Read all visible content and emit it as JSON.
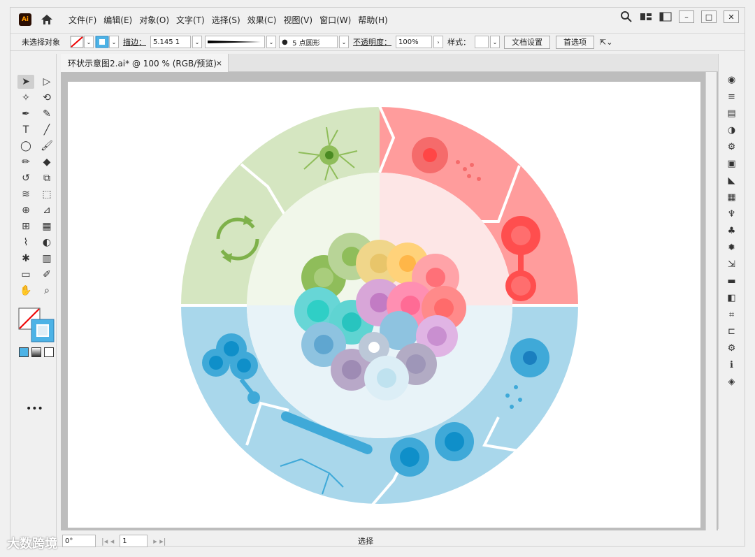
{
  "app": {
    "logo_text": "Ai"
  },
  "menu": [
    "文件(F)",
    "编辑(E)",
    "对象(O)",
    "文字(T)",
    "选择(S)",
    "效果(C)",
    "视图(V)",
    "窗口(W)",
    "帮助(H)"
  ],
  "control_bar": {
    "selection_status": "未选择对象",
    "stroke_label": "描边：",
    "stroke_value": "5.145 1",
    "brush_label": "5 点圆形",
    "opacity_label": "不透明度：",
    "opacity_value": "100%",
    "style_label": "样式：",
    "doc_setup_button": "文档设置",
    "preferences_button": "首选项"
  },
  "document_tab": {
    "title": "环状示意图2.ai* @ 100 % (RGB/预览)",
    "close": "×"
  },
  "status_bar": {
    "angle": "0°",
    "page": "1",
    "tool_label": "选择"
  },
  "watermark": "大数跨境",
  "colors": {
    "green": "#d5e6c1",
    "red": "#ff9c9c",
    "blue": "#a9d7eb",
    "center_green": "#f1f7ea",
    "center_red": "#fde6e6",
    "center_blue": "#e8f3f8"
  },
  "toolbar_icons": [
    "selection-tool",
    "direct-selection-tool",
    "magic-wand-tool",
    "lasso-tool",
    "pen-tool",
    "curvature-tool",
    "type-tool",
    "line-tool",
    "ellipse-tool",
    "paintbrush-tool",
    "pencil-tool",
    "eraser-tool",
    "rotate-tool",
    "scale-tool",
    "warp-tool",
    "free-transform-tool",
    "shape-builder-tool",
    "perspective-tool",
    "mesh-tool",
    "gradient-tool",
    "eyedropper-tool",
    "blend-tool",
    "symbol-sprayer-tool",
    "graph-tool",
    "artboard-tool",
    "slice-tool",
    "hand-tool",
    "zoom-tool"
  ],
  "panel_icons": [
    "color-icon",
    "stroke-icon",
    "gradient-icon",
    "transparency-icon",
    "properties-icon",
    "library-icon",
    "appearance-icon",
    "swatches-icon",
    "brushes-icon",
    "symbols-icon",
    "sun-icon",
    "export-icon",
    "comment-icon",
    "pathfinder-icon",
    "transform-icon",
    "align-icon",
    "settings-icon",
    "info-icon",
    "layers-icon"
  ]
}
